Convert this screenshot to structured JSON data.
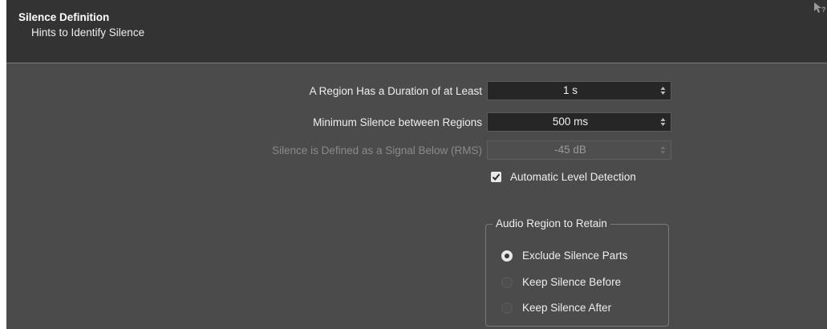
{
  "header": {
    "title": "Silence Definition",
    "subtitle": "Hints to Identify Silence",
    "help_icon": "help-pointer-icon"
  },
  "fields": [
    {
      "label": "A Region Has a Duration of at Least",
      "value": "1 s",
      "enabled": true
    },
    {
      "label": "Minimum Silence between Regions",
      "value": "500 ms",
      "enabled": true
    },
    {
      "label": "Silence is Defined as a Signal Below (RMS)",
      "value": "-45 dB",
      "enabled": false
    }
  ],
  "auto_detection": {
    "label": "Automatic Level Detection",
    "checked": true
  },
  "retain_group": {
    "title": "Audio Region to Retain",
    "options": [
      {
        "label": "Exclude Silence Parts",
        "selected": true
      },
      {
        "label": "Keep Silence Before",
        "selected": false
      },
      {
        "label": "Keep Silence After",
        "selected": false
      }
    ]
  }
}
